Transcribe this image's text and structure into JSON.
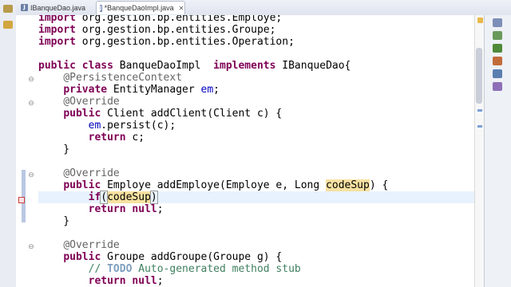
{
  "tabs": [
    {
      "label": "IBanqueDao.java",
      "active": false
    },
    {
      "label": "*BanqueDaoImpl.java",
      "active": true,
      "close": "✕"
    }
  ],
  "icons": {
    "java_file": "J",
    "fold_expanded": "⊖",
    "fold_collapsed": "⊕"
  },
  "code_lines": [
    {
      "segments": [
        {
          "t": "kw",
          "v": "import"
        },
        {
          "t": "",
          "v": " org.gestion.bp.entities.Employe;"
        }
      ]
    },
    {
      "segments": [
        {
          "t": "kw",
          "v": "import"
        },
        {
          "t": "",
          "v": " org.gestion.bp.entities.Groupe;"
        }
      ]
    },
    {
      "segments": [
        {
          "t": "kw",
          "v": "import"
        },
        {
          "t": "",
          "v": " org.gestion.bp.entities.Operation;"
        }
      ]
    },
    {
      "segments": []
    },
    {
      "segments": [
        {
          "t": "kw",
          "v": "public"
        },
        {
          "t": "",
          "v": " "
        },
        {
          "t": "kw",
          "v": "class"
        },
        {
          "t": "",
          "v": " BanqueDaoImpl  "
        },
        {
          "t": "kw",
          "v": "implements"
        },
        {
          "t": "",
          "v": " IBanqueDao{"
        }
      ]
    },
    {
      "segments": [
        {
          "t": "",
          "v": "    "
        },
        {
          "t": "ann",
          "v": "@PersistenceContext"
        }
      ]
    },
    {
      "segments": [
        {
          "t": "",
          "v": "    "
        },
        {
          "t": "kw",
          "v": "private"
        },
        {
          "t": "",
          "v": " EntityManager "
        },
        {
          "t": "fld",
          "v": "em"
        },
        {
          "t": "",
          "v": ";"
        }
      ]
    },
    {
      "segments": [
        {
          "t": "",
          "v": "    "
        },
        {
          "t": "ann",
          "v": "@Override"
        }
      ]
    },
    {
      "segments": [
        {
          "t": "",
          "v": "    "
        },
        {
          "t": "kw",
          "v": "public"
        },
        {
          "t": "",
          "v": " Client addClient(Client c) {"
        }
      ]
    },
    {
      "segments": [
        {
          "t": "",
          "v": "        "
        },
        {
          "t": "fld",
          "v": "em"
        },
        {
          "t": "",
          "v": ".persist(c);"
        }
      ]
    },
    {
      "segments": [
        {
          "t": "",
          "v": "        "
        },
        {
          "t": "kw",
          "v": "return"
        },
        {
          "t": "",
          "v": " c;"
        }
      ]
    },
    {
      "segments": [
        {
          "t": "",
          "v": "    }"
        }
      ]
    },
    {
      "segments": []
    },
    {
      "segments": [
        {
          "t": "",
          "v": "    "
        },
        {
          "t": "ann",
          "v": "@Override"
        }
      ]
    },
    {
      "segments": [
        {
          "t": "",
          "v": "    "
        },
        {
          "t": "kw",
          "v": "public"
        },
        {
          "t": "",
          "v": " Employe addEmploye(Employe e, Long "
        },
        {
          "t": "hl",
          "v": "codeSup"
        },
        {
          "t": "",
          "v": ") {"
        }
      ]
    },
    {
      "current": true,
      "segments": [
        {
          "t": "",
          "v": "        "
        },
        {
          "t": "kw",
          "v": "if"
        },
        {
          "t": "paren",
          "v": "("
        },
        {
          "t": "hl",
          "v": "codeSup"
        },
        {
          "t": "paren",
          "v": ")"
        },
        {
          "t": "caret",
          "v": ""
        }
      ]
    },
    {
      "segments": [
        {
          "t": "",
          "v": "        "
        },
        {
          "t": "kw",
          "v": "return"
        },
        {
          "t": "",
          "v": " "
        },
        {
          "t": "kw",
          "v": "null"
        },
        {
          "t": "",
          "v": ";"
        }
      ]
    },
    {
      "segments": [
        {
          "t": "",
          "v": "    }"
        }
      ]
    },
    {
      "segments": []
    },
    {
      "segments": [
        {
          "t": "",
          "v": "    "
        },
        {
          "t": "ann",
          "v": "@Override"
        }
      ]
    },
    {
      "segments": [
        {
          "t": "",
          "v": "    "
        },
        {
          "t": "kw",
          "v": "public"
        },
        {
          "t": "",
          "v": " Groupe addGroupe(Groupe g) {"
        }
      ]
    },
    {
      "segments": [
        {
          "t": "",
          "v": "        "
        },
        {
          "t": "cmt",
          "v": "// "
        },
        {
          "t": "todo",
          "v": "TODO"
        },
        {
          "t": "cmt",
          "v": " Auto-generated method stub"
        }
      ]
    },
    {
      "segments": [
        {
          "t": "",
          "v": "        "
        },
        {
          "t": "kw",
          "v": "return"
        },
        {
          "t": "",
          "v": " "
        },
        {
          "t": "kw",
          "v": "null"
        },
        {
          "t": "",
          "v": ";"
        }
      ]
    }
  ],
  "colors": {
    "keyword": "#7f0055",
    "annotation": "#646464",
    "field": "#0000c0",
    "comment": "#3f7f5f",
    "occurrence_highlight": "#f7e1a1",
    "current_line": "#e8f2fe"
  }
}
